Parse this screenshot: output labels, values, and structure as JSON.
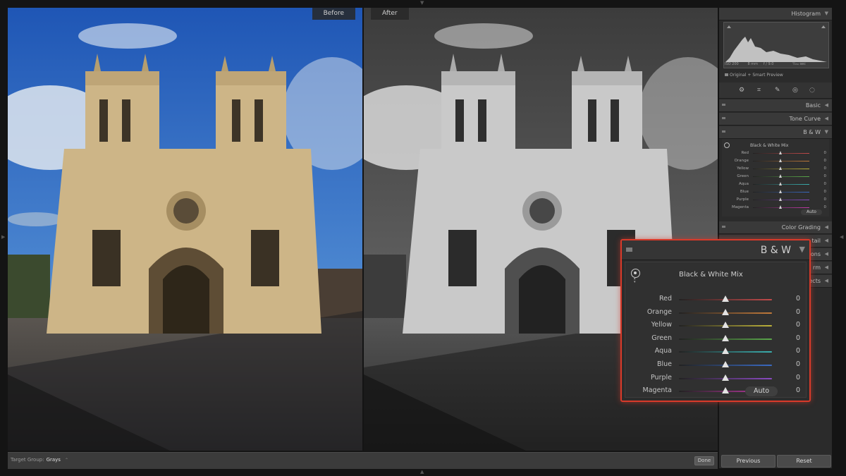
{
  "photo": {
    "before_label": "Before",
    "after_label": "After"
  },
  "toolbar": {
    "target_group_label": "Target Group:",
    "target_group_value": "Grays",
    "target_group_caret": "⌃",
    "done_label": "Done"
  },
  "right_panel": {
    "histogram": {
      "title": "Histogram",
      "iso": "ISO 200",
      "focal": "8 mm",
      "aperture": "f / 9.0",
      "shutter": "¹⁄₂₅₀ sec",
      "preview_label": "Original + Smart Preview"
    },
    "sections": {
      "basic": "Basic",
      "tone_curve": "Tone Curve",
      "bw": "B & W",
      "color_grading": "Color Grading"
    },
    "hidden_sections_partial": [
      "tail",
      "ons",
      "rm",
      "ects"
    ],
    "buttons": {
      "previous": "Previous",
      "reset": "Reset"
    }
  },
  "bw_mix": {
    "panel_title": "B & W",
    "mix_title": "Black & White Mix",
    "auto_label": "Auto",
    "channels": [
      {
        "name": "Red",
        "value": "0",
        "color": "#c24a4a"
      },
      {
        "name": "Orange",
        "value": "0",
        "color": "#c27a3a"
      },
      {
        "name": "Yellow",
        "value": "0",
        "color": "#bdb23a"
      },
      {
        "name": "Green",
        "value": "0",
        "color": "#5aa84a"
      },
      {
        "name": "Aqua",
        "value": "0",
        "color": "#3aaeae"
      },
      {
        "name": "Blue",
        "value": "0",
        "color": "#3a6ac2"
      },
      {
        "name": "Purple",
        "value": "0",
        "color": "#8a4ac2"
      },
      {
        "name": "Magenta",
        "value": "0",
        "color": "#c23aa8"
      }
    ]
  },
  "colors": {
    "accent_callout": "#d93a2a"
  }
}
